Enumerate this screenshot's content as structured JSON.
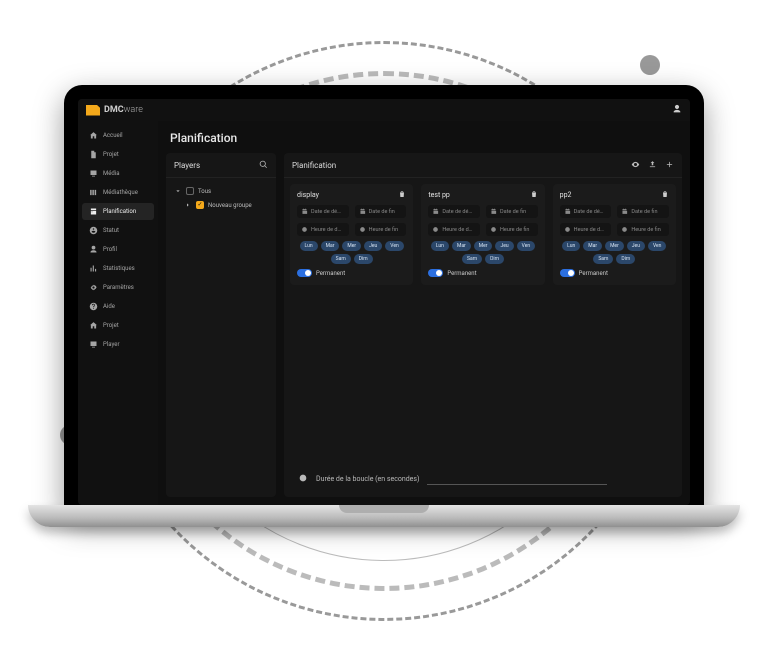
{
  "brand": {
    "name_strong": "DMC",
    "name_light": "ware"
  },
  "page": {
    "title": "Planification"
  },
  "sidebar": {
    "items": [
      {
        "key": "accueil",
        "label": "Accueil"
      },
      {
        "key": "projet",
        "label": "Projet"
      },
      {
        "key": "media",
        "label": "Média"
      },
      {
        "key": "mediatheque",
        "label": "Médiathèque"
      },
      {
        "key": "planification",
        "label": "Planification"
      },
      {
        "key": "statut",
        "label": "Statut"
      },
      {
        "key": "profil",
        "label": "Profil"
      },
      {
        "key": "statistiques",
        "label": "Statistiques"
      },
      {
        "key": "parametres",
        "label": "Paramètres"
      },
      {
        "key": "aide",
        "label": "Aide"
      },
      {
        "key": "projet2",
        "label": "Projet"
      },
      {
        "key": "player",
        "label": "Player"
      }
    ],
    "active_key": "planification"
  },
  "players_panel": {
    "title": "Players",
    "tree": {
      "root_label": "Tous",
      "group_label": "Nouveau groupe"
    }
  },
  "plan_panel": {
    "title": "Planification",
    "fields": {
      "date_start": "Date de dé…",
      "date_end": "Date de fin",
      "time_start": "Heure de d…",
      "time_end": "Heure de fin"
    },
    "days": [
      "Lun",
      "Mar",
      "Mer",
      "Jeu",
      "Ven",
      "Sam",
      "Dim"
    ],
    "permanent_label": "Permanent",
    "cards": [
      {
        "title": "display"
      },
      {
        "title": "test pp"
      },
      {
        "title": "pp2"
      }
    ],
    "loop_label": "Durée de la boucle (en secondes)"
  }
}
